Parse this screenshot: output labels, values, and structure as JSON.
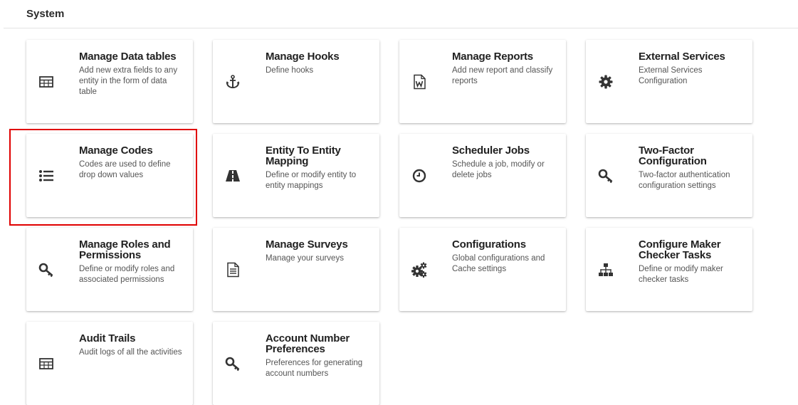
{
  "section": {
    "title": "System"
  },
  "cards": [
    {
      "title": "Manage Data tables",
      "description": "Add new extra fields to any entity in the form of data table",
      "icon": "table-icon"
    },
    {
      "title": "Manage Hooks",
      "description": "Define hooks",
      "icon": "anchor-icon"
    },
    {
      "title": "Manage Reports",
      "description": "Add new report and classify reports",
      "icon": "word-file-icon"
    },
    {
      "title": "External Services",
      "description": "External Services Configuration",
      "icon": "gear-icon"
    },
    {
      "title": "Manage Codes",
      "description": "Codes are used to define drop down values",
      "icon": "list-icon"
    },
    {
      "title": "Entity To Entity Mapping",
      "description": "Define or modify entity to entity mappings",
      "icon": "road-icon"
    },
    {
      "title": "Scheduler Jobs",
      "description": "Schedule a job, modify or delete jobs",
      "icon": "clock-icon"
    },
    {
      "title": "Two-Factor Configuration",
      "description": "Two-factor authentication configuration settings",
      "icon": "key-icon"
    },
    {
      "title": "Manage Roles and Permissions",
      "description": "Define or modify roles and associated permissions",
      "icon": "key-icon"
    },
    {
      "title": "Manage Surveys",
      "description": "Manage your surveys",
      "icon": "file-text-icon"
    },
    {
      "title": "Configurations",
      "description": "Global configurations and Cache settings",
      "icon": "gears-icon"
    },
    {
      "title": "Configure Maker Checker Tasks",
      "description": "Define or modify maker checker tasks",
      "icon": "sitemap-icon"
    },
    {
      "title": "Audit Trails",
      "description": "Audit logs of all the activities",
      "icon": "table-icon"
    },
    {
      "title": "Account Number Preferences",
      "description": "Preferences for generating account numbers",
      "icon": "key-icon"
    }
  ]
}
